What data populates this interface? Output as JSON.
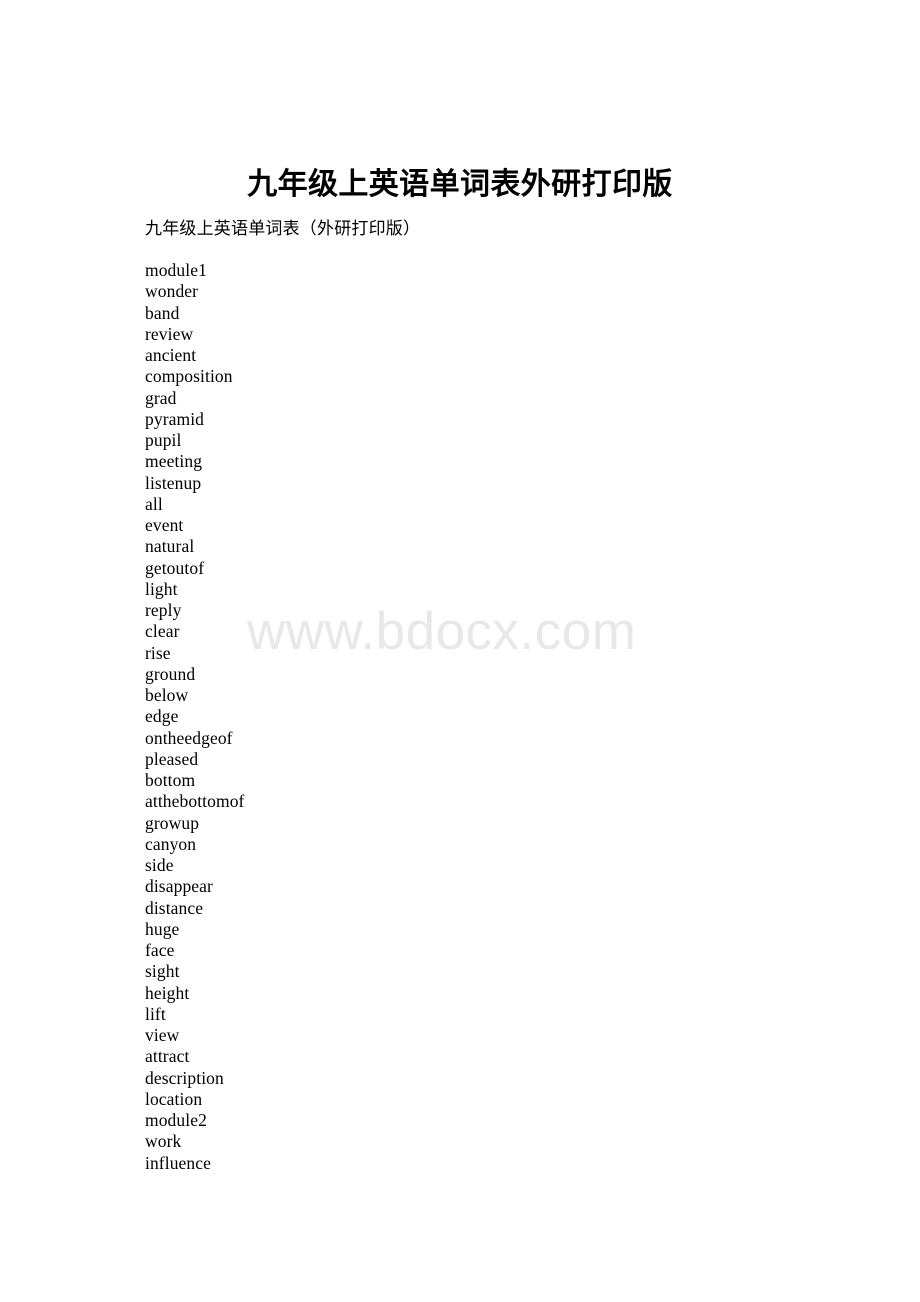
{
  "document": {
    "title": "九年级上英语单词表外研打印版",
    "subtitle": "九年级上英语单词表（外研打印版）",
    "watermark": "www.bdocx.com",
    "watermark_color": "#e8e8e8",
    "text_color": "#000000",
    "background_color": "#ffffff",
    "words": [
      "module1",
      "wonder",
      "band",
      "review",
      "ancient",
      "composition",
      "grad",
      "pyramid",
      "pupil",
      "meeting",
      "listenup",
      "all",
      "event",
      "natural",
      "getoutof",
      "light",
      "reply",
      "clear",
      "rise",
      "ground",
      "below",
      "edge",
      "ontheedgeof",
      "pleased",
      "bottom",
      "atthebottomof",
      "growup",
      "canyon",
      "side",
      "disappear",
      "distance",
      "huge",
      "face",
      "sight",
      "height",
      "lift",
      "view",
      "attract",
      "description",
      "location",
      "module2",
      "work",
      "influence"
    ]
  }
}
